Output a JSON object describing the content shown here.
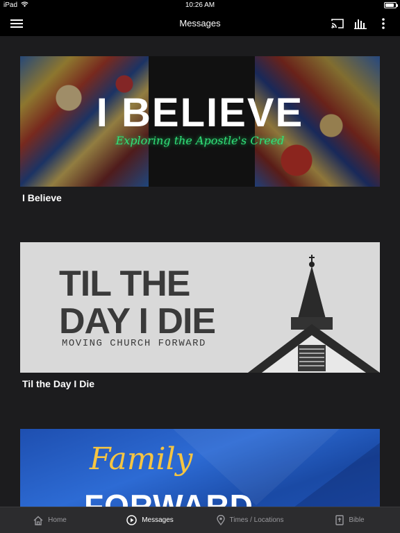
{
  "status": {
    "device": "iPad",
    "time": "10:26 AM",
    "battery_level": 0.85
  },
  "nav": {
    "title": "Messages"
  },
  "messages": [
    {
      "title": "I Believe",
      "art_title": "I BELIEVE",
      "art_subtitle": "Exploring the Apostle's Creed"
    },
    {
      "title": "Til the Day I Die",
      "art_line1": "TIL THE",
      "art_line2": "DAY I DIE",
      "art_subtitle": "MOVING CHURCH FORWARD"
    },
    {
      "art_line1": "Family",
      "art_line2": "FORWARD"
    }
  ],
  "tabs": [
    {
      "label": "Home",
      "icon": "home-icon"
    },
    {
      "label": "Messages",
      "icon": "play-circle-icon",
      "active": true
    },
    {
      "label": "Times / Locations",
      "icon": "location-pin-icon"
    },
    {
      "label": "Bible",
      "icon": "bible-icon"
    }
  ],
  "colors": {
    "background": "#1c1c1e",
    "bars": "#000000",
    "tab_bar": "#2c2c2e",
    "inactive_tab": "#9a9a9e",
    "accent_green": "#31e07a",
    "accent_gold": "#f5c542"
  }
}
